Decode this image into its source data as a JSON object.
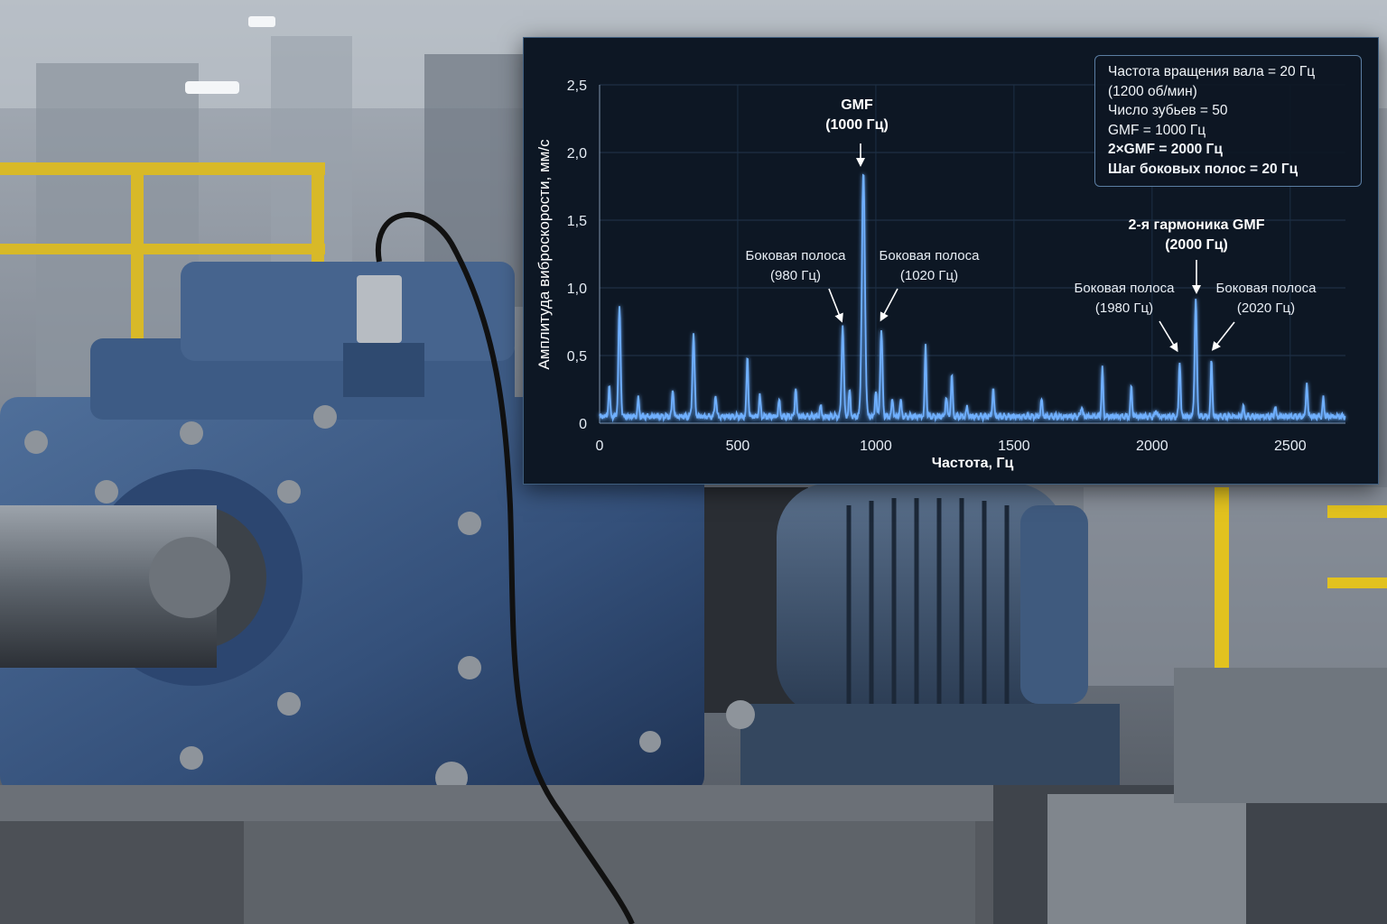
{
  "info_box": {
    "line1": "Частота вращения вала = 20 Гц",
    "line2": "(1200 об/мин)",
    "line3": "Число зубьев = 50",
    "line4": "GMF = 1000 Гц",
    "line5": "2×GMF = 2000 Гц",
    "line6": "Шаг боковых полос = 20 Гц"
  },
  "annotations": {
    "gmf_title": "GMF",
    "gmf_value": "(1000 Гц)",
    "harm_title": "2-я гармоника GMF",
    "harm_value": "(2000 Гц)",
    "sb_label": "Боковая полоса",
    "sb980": "(980 Гц)",
    "sb1020": "(1020 Гц)",
    "sb1980": "(1980 Гц)",
    "sb2020": "(2020 Гц)"
  },
  "chart_data": {
    "type": "line",
    "xlabel": "Частота, Гц",
    "ylabel": "Амплитуда виброскорости, мм/с",
    "xlim": [
      0,
      2700
    ],
    "ylim": [
      0,
      2.5
    ],
    "x_ticks": [
      "0",
      "500",
      "1000",
      "1500",
      "2000",
      "2500"
    ],
    "y_ticks": [
      "0",
      "0,5",
      "1,0",
      "1,5",
      "2,0",
      "2,5"
    ],
    "grid": true,
    "line_color": "#6fb0ff",
    "noise_floor": 0.05,
    "peaks": [
      {
        "x": 35,
        "y": 0.28
      },
      {
        "x": 72,
        "y": 0.85
      },
      {
        "x": 140,
        "y": 0.18
      },
      {
        "x": 265,
        "y": 0.26
      },
      {
        "x": 340,
        "y": 0.65
      },
      {
        "x": 420,
        "y": 0.22
      },
      {
        "x": 535,
        "y": 0.5
      },
      {
        "x": 580,
        "y": 0.2
      },
      {
        "x": 650,
        "y": 0.17
      },
      {
        "x": 710,
        "y": 0.27
      },
      {
        "x": 800,
        "y": 0.13
      },
      {
        "x": 880,
        "y": 0.72
      },
      {
        "x": 905,
        "y": 0.25
      },
      {
        "x": 955,
        "y": 1.85
      },
      {
        "x": 1000,
        "y": 0.25
      },
      {
        "x": 1020,
        "y": 0.68
      },
      {
        "x": 1060,
        "y": 0.18
      },
      {
        "x": 1090,
        "y": 0.17
      },
      {
        "x": 1180,
        "y": 0.57
      },
      {
        "x": 1255,
        "y": 0.2
      },
      {
        "x": 1275,
        "y": 0.36
      },
      {
        "x": 1330,
        "y": 0.12
      },
      {
        "x": 1425,
        "y": 0.26
      },
      {
        "x": 1600,
        "y": 0.18
      },
      {
        "x": 1745,
        "y": 0.13
      },
      {
        "x": 1820,
        "y": 0.4
      },
      {
        "x": 1925,
        "y": 0.27
      },
      {
        "x": 2015,
        "y": 0.1
      },
      {
        "x": 2100,
        "y": 0.47
      },
      {
        "x": 2158,
        "y": 0.91
      },
      {
        "x": 2215,
        "y": 0.47
      },
      {
        "x": 2330,
        "y": 0.12
      },
      {
        "x": 2445,
        "y": 0.12
      },
      {
        "x": 2560,
        "y": 0.3
      },
      {
        "x": 2620,
        "y": 0.18
      }
    ]
  }
}
